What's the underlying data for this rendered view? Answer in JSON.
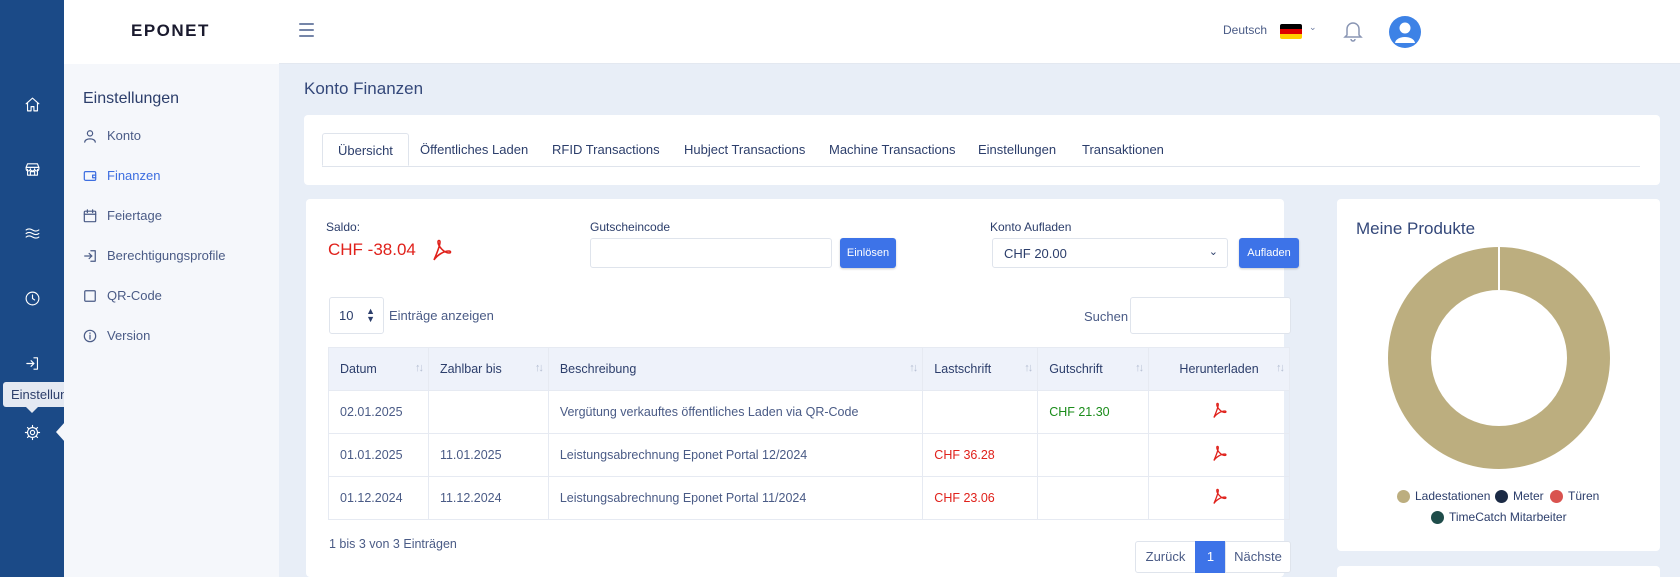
{
  "app": {
    "logo": "EPONET"
  },
  "rail": {
    "tooltip": "Einstellungen"
  },
  "topbar": {
    "language": "Deutsch"
  },
  "subnav": {
    "title": "Einstellungen",
    "items": [
      {
        "label": "Konto",
        "icon": "user-icon"
      },
      {
        "label": "Finanzen",
        "icon": "wallet-icon"
      },
      {
        "label": "Feiertage",
        "icon": "calendar-icon"
      },
      {
        "label": "Berechtigungsprofile",
        "icon": "login-icon"
      },
      {
        "label": "QR-Code",
        "icon": "qrcode-icon"
      },
      {
        "label": "Version",
        "icon": "info-icon"
      }
    ]
  },
  "page": {
    "title": "Konto Finanzen"
  },
  "tabs": [
    {
      "label": "Übersicht"
    },
    {
      "label": "Öffentliches Laden"
    },
    {
      "label": "RFID Transactions"
    },
    {
      "label": "Hubject Transactions"
    },
    {
      "label": "Machine Transactions"
    },
    {
      "label": "Einstellungen"
    },
    {
      "label": "Transaktionen"
    }
  ],
  "finance": {
    "saldo_label": "Saldo:",
    "saldo_value": "CHF -38.04",
    "voucher_label": "Gutscheincode",
    "voucher_value": "",
    "redeem_button": "Einlösen",
    "topup_label": "Konto Aufladen",
    "topup_selected": "CHF 20.00",
    "topup_button": "Aufladen"
  },
  "table": {
    "entries_value": "10",
    "entries_label": "Einträge anzeigen",
    "search_label": "Suchen",
    "search_value": "",
    "columns": [
      "Datum",
      "Zahlbar bis",
      "Beschreibung",
      "Lastschrift",
      "Gutschrift",
      "Herunterladen"
    ],
    "rows": [
      {
        "datum": "02.01.2025",
        "zahlbar": "",
        "beschreibung": "Vergütung verkauftes öffentliches Laden via QR-Code",
        "lastschrift": "",
        "gutschrift": "CHF 21.30"
      },
      {
        "datum": "01.01.2025",
        "zahlbar": "11.01.2025",
        "beschreibung": "Leistungsabrechnung Eponet Portal 12/2024",
        "lastschrift": "CHF 36.28",
        "gutschrift": ""
      },
      {
        "datum": "01.12.2024",
        "zahlbar": "11.12.2024",
        "beschreibung": "Leistungsabrechnung Eponet Portal 11/2024",
        "lastschrift": "CHF 23.06",
        "gutschrift": ""
      }
    ],
    "info": "1 bis 3 von 3 Einträgen",
    "pager": {
      "prev": "Zurück",
      "page": "1",
      "next": "Nächste"
    }
  },
  "products": {
    "title": "Meine Produkte",
    "legend": [
      {
        "label": "Ladestationen",
        "color": "#bcae7f"
      },
      {
        "label": "Meter",
        "color": "#1b2a45"
      },
      {
        "label": "Türen",
        "color": "#d9534f"
      },
      {
        "label": "TimeCatch Mitarbeiter",
        "color": "#1f4d4a"
      }
    ],
    "share": [
      1,
      0,
      0,
      0
    ]
  },
  "colors": {
    "rail": "#1b4a87",
    "accent": "#3d73e8",
    "debit": "#e0211b",
    "credit": "#1a8c1a"
  }
}
